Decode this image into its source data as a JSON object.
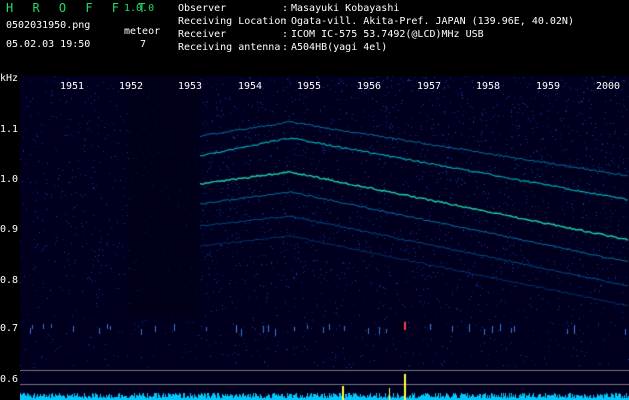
{
  "header": {
    "app_title": "H R O F F T",
    "version": "1.0.0",
    "file_name": "0502031950.png",
    "meteor_label": "meteor",
    "meteor_count": "7",
    "datetime": "05.02.03 19:50",
    "fields": [
      {
        "label": "Observer",
        "value": "Masayuki Kobayashi"
      },
      {
        "label": "Receiving Location",
        "value": "Ogata-vill. Akita-Pref. JAPAN (139.96E, 40.02N)"
      },
      {
        "label": "Receiver",
        "value": "ICOM IC-575 53.7492(@LCD)MHz USB"
      },
      {
        "label": "Receiving antenna",
        "value": "A504HB(yagi 4el)"
      }
    ]
  },
  "axes": {
    "y_unit": "kHz",
    "x_ticks": [
      "1951",
      "1952",
      "1953",
      "1954",
      "1955",
      "1956",
      "1957",
      "1958",
      "1959",
      "2000"
    ],
    "y_ticks": [
      "1.1",
      "1.0",
      "0.9",
      "0.8",
      "0.7",
      "0.6"
    ]
  },
  "colors": {
    "background": "#000000",
    "plot_bg": "#000030",
    "accent_green": "#22dd66",
    "trace_cyan": "#00e0ff",
    "meteor_yellow": "#ffff40"
  }
}
